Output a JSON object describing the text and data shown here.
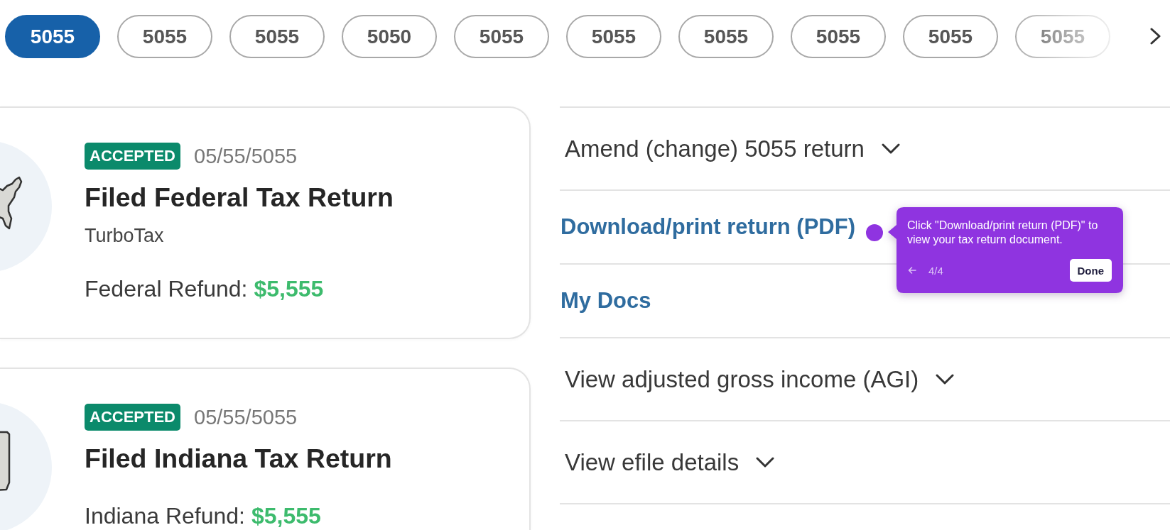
{
  "year_tabs": [
    {
      "label": "5055",
      "selected": true
    },
    {
      "label": "5055",
      "selected": false
    },
    {
      "label": "5055",
      "selected": false
    },
    {
      "label": "5050",
      "selected": false
    },
    {
      "label": "5055",
      "selected": false
    },
    {
      "label": "5055",
      "selected": false
    },
    {
      "label": "5055",
      "selected": false
    },
    {
      "label": "5055",
      "selected": false
    },
    {
      "label": "5055",
      "selected": false
    },
    {
      "label": "5055",
      "selected": false
    }
  ],
  "returns": [
    {
      "kind": "federal",
      "status": "ACCEPTED",
      "date": "05/55/5055",
      "title": "Filed Federal Tax Return",
      "source": "TurboTax",
      "refund_label": "Federal Refund:",
      "refund_amount": "$5,555"
    },
    {
      "kind": "state",
      "status": "ACCEPTED",
      "date": "05/55/5055",
      "title": "Filed Indiana Tax Return",
      "refund_label": "Indiana Refund:",
      "refund_amount": "$5,555"
    }
  ],
  "actions": [
    {
      "kind": "expander",
      "label": "Amend (change) 5055 return",
      "expanded": false
    },
    {
      "kind": "link",
      "label": "Download/print return (PDF)"
    },
    {
      "kind": "link",
      "label": "My Docs"
    },
    {
      "kind": "expander",
      "label": "View adjusted gross income (AGI)",
      "expanded": false
    },
    {
      "kind": "expander",
      "label": "View efile details",
      "expanded": false
    }
  ],
  "tour_tooltip": {
    "text": "Click \"Download/print return (PDF)\" to view your tax return document.",
    "step": "4/4",
    "done_button": "Done"
  }
}
